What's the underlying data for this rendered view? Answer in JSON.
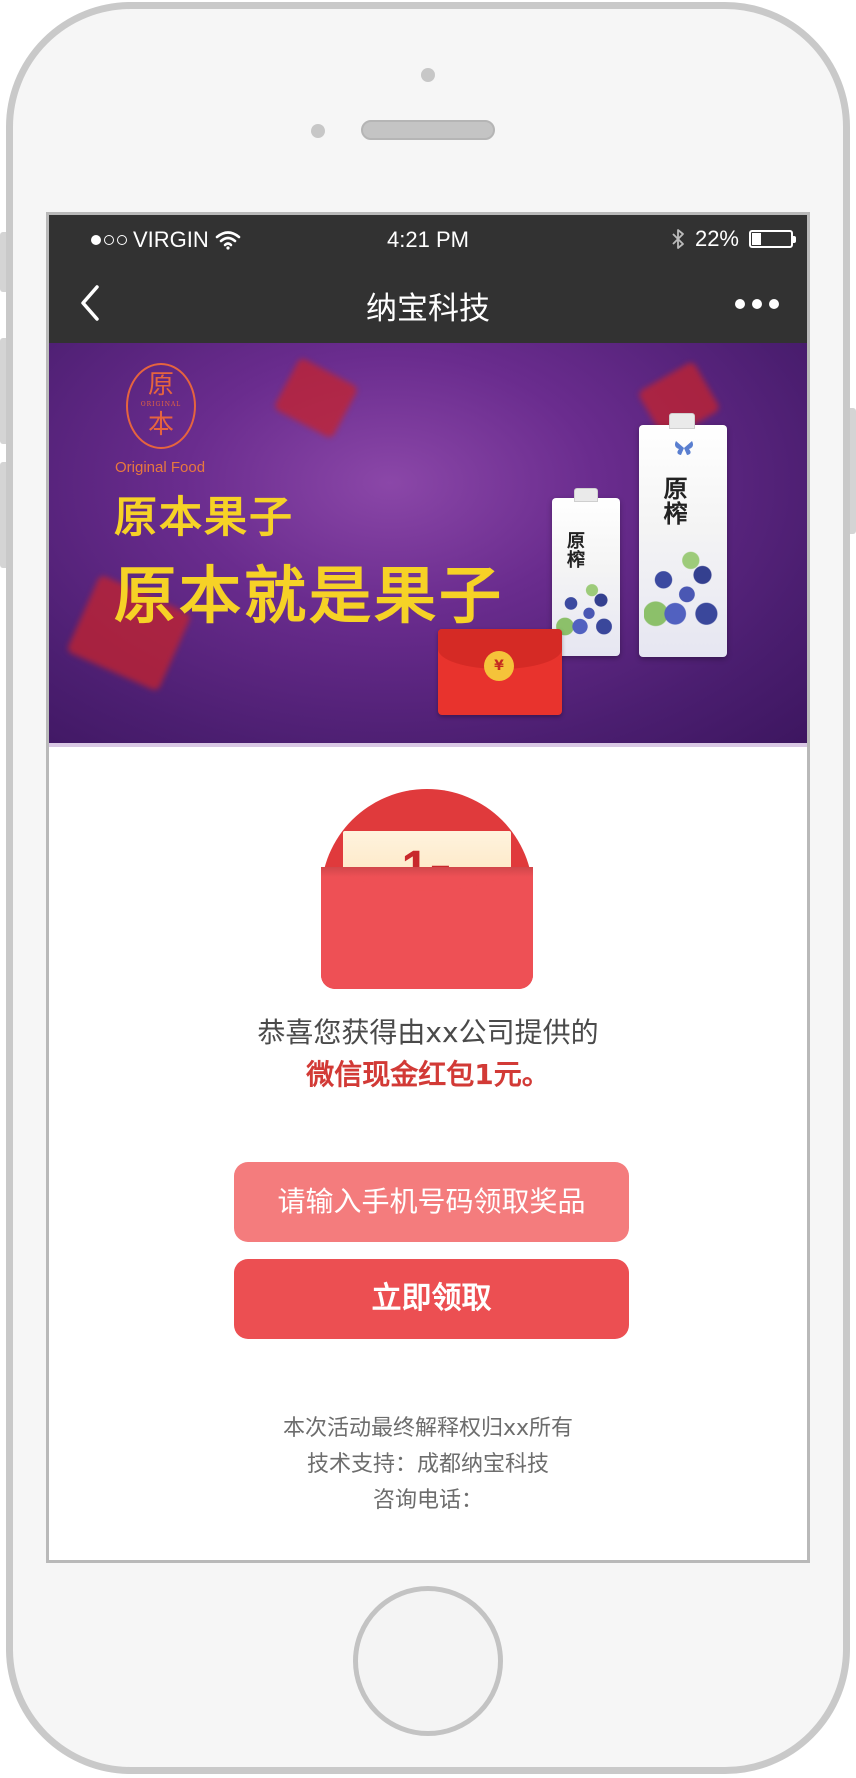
{
  "status_bar": {
    "carrier": "VIRGIN",
    "time": "4:21 PM",
    "battery_percent": "22%",
    "battery_level": 0.22,
    "signal_dots": 3,
    "signal_filled": 1,
    "icons": [
      "wifi-icon",
      "bluetooth-icon",
      "battery-icon"
    ]
  },
  "nav_bar": {
    "title": "纳宝科技",
    "icons": [
      "back-chevron-icon",
      "more-dots-icon"
    ]
  },
  "banner": {
    "logo_char_top": "原",
    "logo_ring_text": "ORIGINAL",
    "logo_char_bottom": "本",
    "logo_subtitle": "Original Food",
    "slogan_line1": "原本果子",
    "slogan_line2": "原本就是果子",
    "product_label": "原榨",
    "colors": {
      "background": "#5a2680",
      "slogan": "#f6d226",
      "logo": "#e6643e"
    }
  },
  "red_packet": {
    "amount": "1",
    "unit": "元",
    "colors": {
      "envelope": "#ee5055",
      "card": "#fbdcaa",
      "amount": "#c8282c"
    }
  },
  "message": {
    "line1": "恭喜您获得由xx公司提供的",
    "line2": "微信现金红包1元。"
  },
  "buttons": {
    "phone_input_label": "请输入手机号码领取奖品",
    "claim_label": "立即领取",
    "colors": {
      "phone_input": "#f47c7d",
      "claim": "#ec4f52"
    }
  },
  "footer": {
    "rights": "本次活动最终解释权归xx所有",
    "support": "技术支持：成都纳宝科技",
    "phone": "咨询电话："
  }
}
